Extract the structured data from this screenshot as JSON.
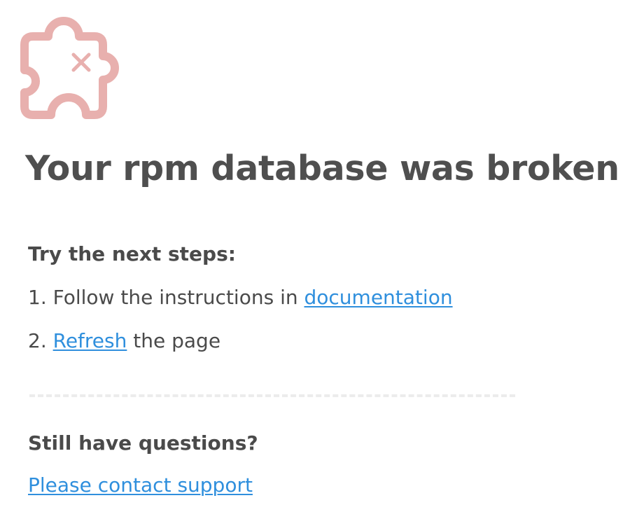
{
  "error": {
    "icon": "puzzle-broken-icon",
    "icon_color": "#e8b0ae",
    "title": "Your rpm database was broken"
  },
  "steps": {
    "heading": "Try the next steps:",
    "step1_prefix": "1. Follow the instructions in ",
    "step1_link": "documentation",
    "step2_prefix": "2. ",
    "step2_link": "Refresh",
    "step2_suffix": " the page"
  },
  "support": {
    "heading": "Still have questions?",
    "link": "Please contact support"
  },
  "colors": {
    "text": "#4f4f4f",
    "link": "#2f8fdd",
    "divider": "#ececec"
  }
}
